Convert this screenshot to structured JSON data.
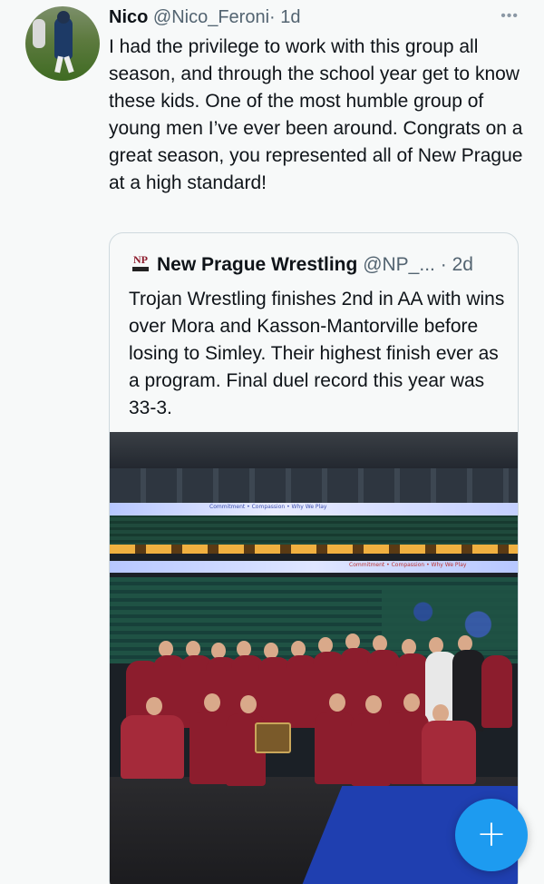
{
  "tweet": {
    "author_name": "Nico",
    "author_handle": "@Nico_Feroni",
    "separator": "·",
    "time": "1d",
    "more_icon": "ellipsis-icon",
    "text": "I had the privilege to work with this group all season, and through the school year get to know these kids. One of the most humble group of young men I’ve ever been around. Congrats on a great season, you represented all of New Prague at a high standard!"
  },
  "quoted": {
    "logo_text": "NP",
    "author_name": "New Prague Wrestling",
    "author_handle": "@NP_...",
    "separator": "·",
    "time": "2d",
    "text": "Trojan Wrestling finishes 2nd in AA with wins over Mora and Kasson-Mantorville before losing to Simley. Their highest finish ever as a program. Final duel record this year was 33-3.",
    "photo_ribbon_1": "Commitment • Compassion • Why We Play",
    "photo_ribbon_2": "Commitment • Compassion • Why We Play"
  },
  "compose_button": {
    "icon": "plus-icon",
    "symbol": "+",
    "color": "#1d9bf0"
  }
}
